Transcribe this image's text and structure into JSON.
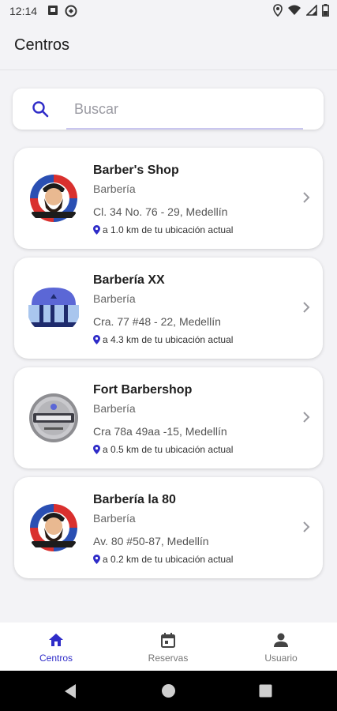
{
  "status_bar": {
    "time": "12:14",
    "left_icons": [
      "notification-square-icon",
      "sync-circle-icon"
    ],
    "right_icons": [
      "location-icon",
      "wifi-icon",
      "signal-icon",
      "battery-icon"
    ]
  },
  "app_bar": {
    "title": "Centros"
  },
  "search": {
    "placeholder": "Buscar",
    "value": ""
  },
  "accent_color": "#2f2cc8",
  "centers": [
    {
      "name": "Barber's Shop",
      "category": "Barbería",
      "address": "Cl. 34 No. 76 - 29, Medellín",
      "distance": "a 1.0 km de tu ubicación actual",
      "logo": "bearded-man-barber-logo"
    },
    {
      "name": "Barbería XX",
      "category": "Barbería",
      "address": "Cra. 77 #48 - 22, Medellín",
      "distance": "a 4.3 km de tu ubicación actual",
      "logo": "storefront-logo"
    },
    {
      "name": "Fort Barbershop",
      "category": "Barbería",
      "address": "Cra 78a 49aa -15, Medellín",
      "distance": "a 0.5 km de tu ubicación actual",
      "logo": "round-metal-sign-logo"
    },
    {
      "name": "Barbería la 80",
      "category": "Barbería",
      "address": "Av. 80 #50-87, Medellín",
      "distance": "a 0.2 km de tu ubicación actual",
      "logo": "bearded-man-barber-logo"
    }
  ],
  "bottom_nav": [
    {
      "label": "Centros",
      "icon": "home-icon",
      "active": true
    },
    {
      "label": "Reservas",
      "icon": "calendar-icon",
      "active": false
    },
    {
      "label": "Usuario",
      "icon": "person-icon",
      "active": false
    }
  ],
  "system_nav": [
    "back-icon",
    "home-circle-icon",
    "recents-icon"
  ]
}
